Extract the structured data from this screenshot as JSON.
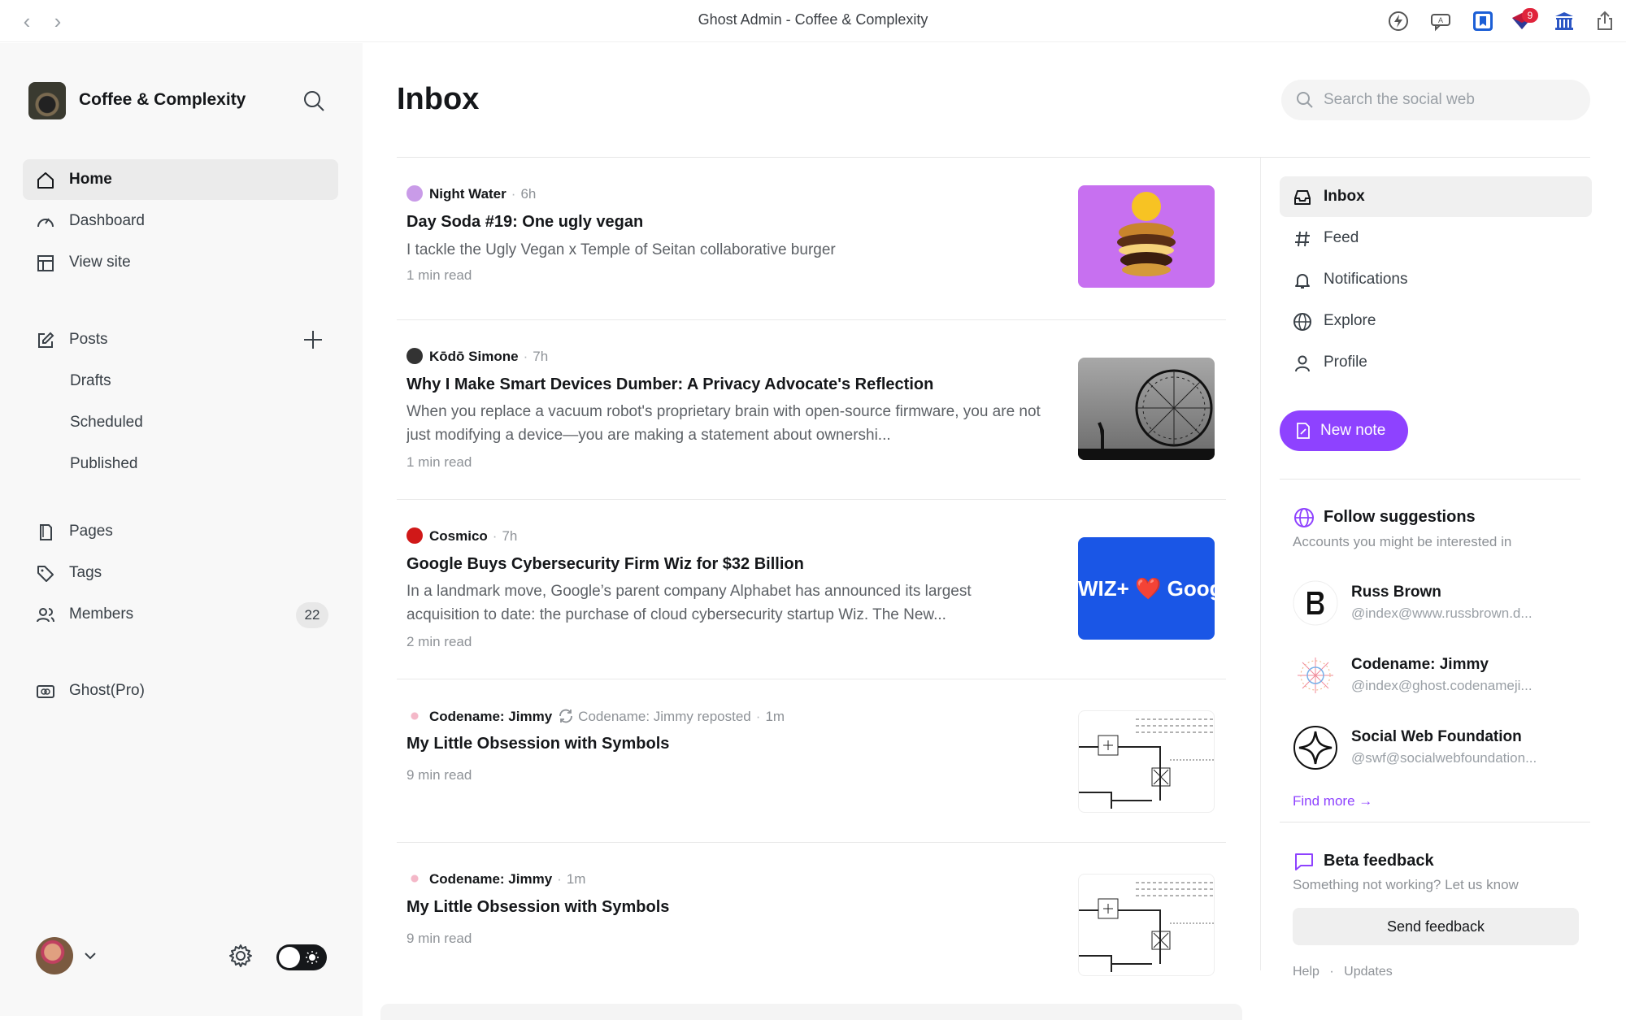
{
  "window": {
    "title": "Ghost Admin - Coffee & Complexity",
    "back": "‹",
    "forward": "›"
  },
  "extensions": {
    "badge_count": "9"
  },
  "sidebar": {
    "site_name": "Coffee & Complexity",
    "nav": [
      {
        "label": "Home",
        "icon": "home-icon"
      },
      {
        "label": "Dashboard",
        "icon": "dashboard-icon"
      },
      {
        "label": "View site",
        "icon": "layout-icon"
      }
    ],
    "posts": {
      "label": "Posts",
      "sub": [
        "Drafts",
        "Scheduled",
        "Published"
      ]
    },
    "nav2": [
      {
        "label": "Pages",
        "icon": "page-icon"
      },
      {
        "label": "Tags",
        "icon": "tag-icon"
      },
      {
        "label": "Members",
        "icon": "members-icon",
        "count": "22"
      }
    ],
    "pro": {
      "label": "Ghost(Pro)"
    }
  },
  "main": {
    "title": "Inbox",
    "search_placeholder": "Search the social web",
    "posts": [
      {
        "author": "Night Water",
        "time": "6h",
        "title": "Day Soda #19: One ugly vegan",
        "excerpt": "I tackle the Ugly Vegan x Temple of Seitan collaborative burger",
        "read": "1 min read"
      },
      {
        "author": "Kōdō Simone",
        "time": "7h",
        "title": "Why I Make Smart Devices Dumber: A Privacy Advocate's Reflection",
        "excerpt": "When you replace a vacuum robot's proprietary brain with open-source firmware, you are not just modifying a device—you are making a statement about ownershi...",
        "read": "1 min read"
      },
      {
        "author": "Cosmico",
        "time": "7h",
        "title": "Google Buys Cybersecurity Firm Wiz for $32 Billion",
        "excerpt": "In a landmark move, Google’s parent company Alphabet has announced its largest acquisition to date: the purchase of cloud cybersecurity startup Wiz. The New...",
        "read": "2 min read",
        "thumb_text": "WIZ+ ❤️ Google"
      },
      {
        "author": "Codename: Jimmy",
        "reposted": "Codename: Jimmy reposted",
        "time": "1m",
        "title": "My Little Obsession with Symbols",
        "read": "9 min read"
      },
      {
        "author": "Codename: Jimmy",
        "time": "1m",
        "title": "My Little Obsession with Symbols",
        "read": "9 min read"
      }
    ]
  },
  "right": {
    "nav": [
      {
        "label": "Inbox",
        "icon": "inbox-icon"
      },
      {
        "label": "Feed",
        "icon": "hash-icon"
      },
      {
        "label": "Notifications",
        "icon": "bell-icon"
      },
      {
        "label": "Explore",
        "icon": "globe-icon"
      },
      {
        "label": "Profile",
        "icon": "user-icon"
      }
    ],
    "new_note": "New note",
    "follow": {
      "title": "Follow suggestions",
      "subtitle": "Accounts you might be interested in",
      "accounts": [
        {
          "name": "Russ Brown",
          "handle": "@index@www.russbrown.d..."
        },
        {
          "name": "Codename: Jimmy",
          "handle": "@index@ghost.codenameji..."
        },
        {
          "name": "Social Web Foundation",
          "handle": "@swf@socialwebfoundation..."
        }
      ],
      "find_more": "Find more →"
    },
    "feedback": {
      "title": "Beta feedback",
      "subtitle": "Something not working? Let us know",
      "button": "Send feedback"
    },
    "footer": {
      "help": "Help",
      "sep": "·",
      "updates": "Updates"
    }
  },
  "colors": {
    "accent": "#8e42ff",
    "text": "#15171a",
    "muted": "#8e9297"
  }
}
